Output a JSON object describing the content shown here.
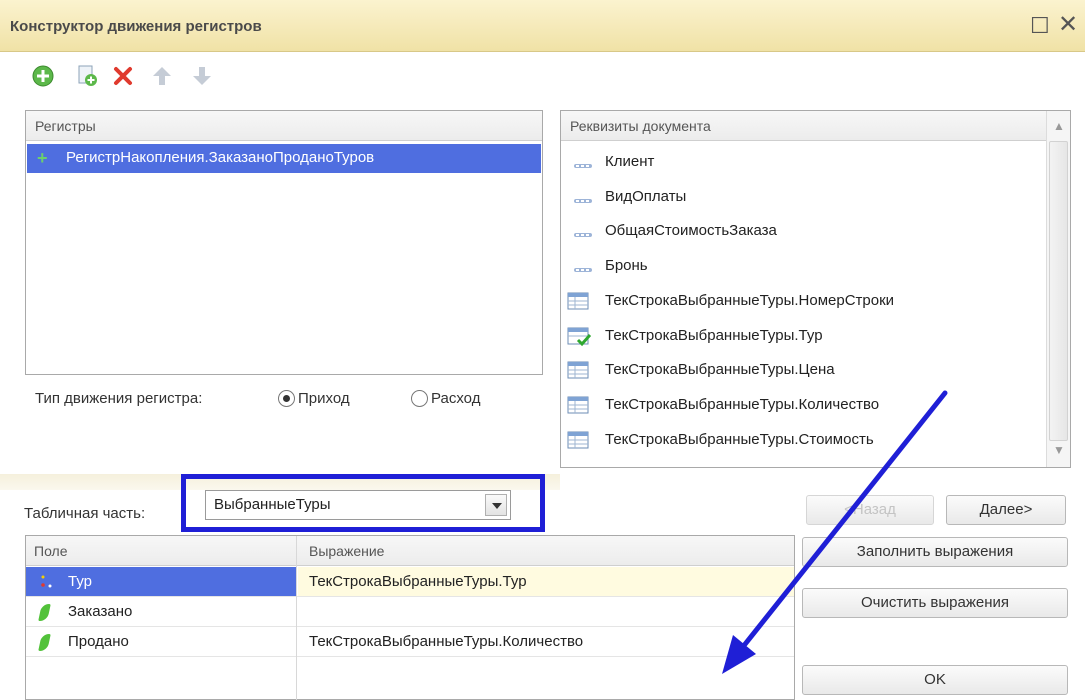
{
  "window": {
    "title": "Конструктор движения регистров",
    "icons": {
      "maximize": "maximize-icon",
      "close": "close-icon"
    }
  },
  "toolbar": {
    "icons": [
      "add-icon",
      "copy-icon",
      "delete-icon",
      "move-up-icon",
      "move-down-icon"
    ]
  },
  "registers": {
    "header": "Регистры",
    "items": [
      {
        "label": "РегистрНакопления.ЗаказаноПроданоТуров",
        "selected": true
      }
    ]
  },
  "attributes": {
    "header": "Реквизиты документа",
    "items": [
      {
        "label": "Клиент",
        "icon": "attribute-icon"
      },
      {
        "label": "ВидОплаты",
        "icon": "attribute-icon"
      },
      {
        "label": "ОбщаяСтоимостьЗаказа",
        "icon": "attribute-icon"
      },
      {
        "label": "Бронь",
        "icon": "attribute-icon"
      },
      {
        "label": "ТекСтрокаВыбранныеТуры.НомерСтроки",
        "icon": "table-field-icon"
      },
      {
        "label": "ТекСтрокаВыбранныеТуры.Тур",
        "icon": "table-field-checked-icon"
      },
      {
        "label": "ТекСтрокаВыбранныеТуры.Цена",
        "icon": "table-field-icon"
      },
      {
        "label": "ТекСтрокаВыбранныеТуры.Количество",
        "icon": "table-field-icon"
      },
      {
        "label": "ТекСтрокаВыбранныеТуры.Стоимость",
        "icon": "table-field-icon"
      }
    ]
  },
  "movement_type": {
    "label": "Тип движения регистра:",
    "options": [
      {
        "label": "Приход",
        "checked": true
      },
      {
        "label": "Расход",
        "checked": false
      }
    ]
  },
  "tabular_part": {
    "label": "Табличная часть:",
    "value": "ВыбранныеТуры"
  },
  "buttons": {
    "back": "<Назад",
    "next": "Далее>",
    "fill": "Заполнить выражения",
    "clear": "Очистить выражения",
    "ok": "OK"
  },
  "grid": {
    "headers": [
      "Поле",
      "Выражение"
    ],
    "rows": [
      {
        "field": "Тур",
        "expression": "ТекСтрокаВыбранныеТуры.Тур",
        "icon": "dimension-icon",
        "selected": true
      },
      {
        "field": "Заказано",
        "expression": "",
        "icon": "resource-icon",
        "selected": false
      },
      {
        "field": "Продано",
        "expression": "ТекСтрокаВыбранныеТуры.Количество",
        "icon": "resource-icon",
        "selected": false
      }
    ]
  },
  "colors": {
    "selection": "#4f6ee0",
    "annotation": "#1f1fd6",
    "title_bar": "#f6ecbd"
  }
}
